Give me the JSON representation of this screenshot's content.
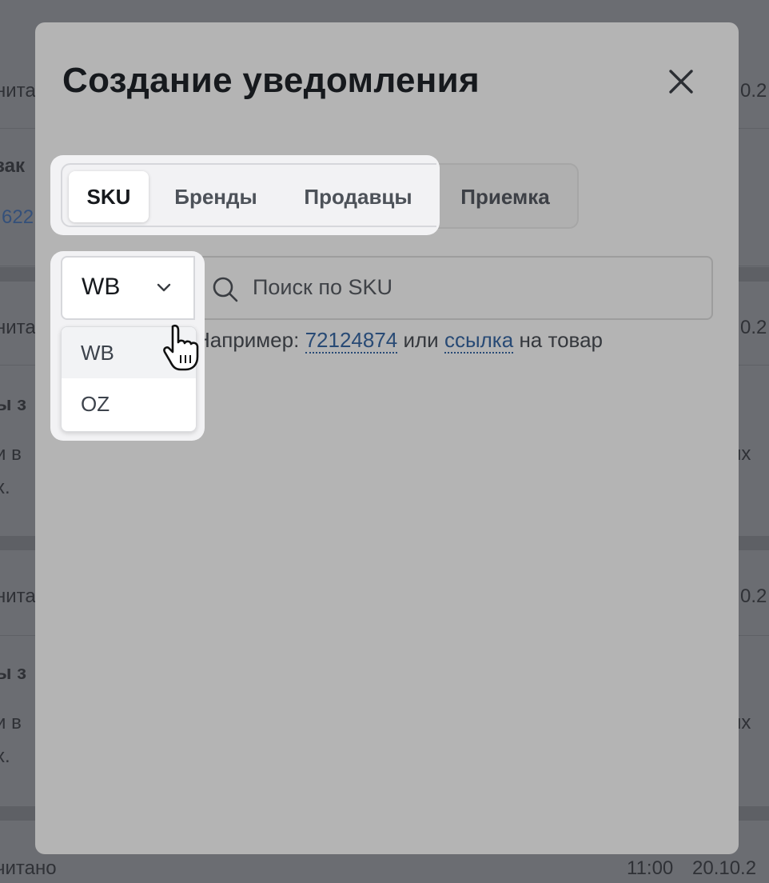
{
  "background": {
    "rows": [
      {
        "text": "нита",
        "right": "0.2"
      },
      {
        "bold": "зак",
        "link": "622"
      },
      {
        "text": "нита",
        "right": "0.2"
      },
      {
        "bold": "ы з",
        "line2": "и в",
        "line3": "х.",
        "right": "их"
      },
      {
        "text": "нита",
        "right": "0.2"
      },
      {
        "bold": "ы з",
        "line2": "и в",
        "line3": "х.",
        "right": "их"
      },
      {
        "text": "читано",
        "time": "11:00",
        "date": "20.10.2"
      }
    ]
  },
  "modal": {
    "title": "Создание уведомления",
    "close_icon": "close-icon",
    "tabs": [
      {
        "label": "SKU",
        "active": true
      },
      {
        "label": "Бренды",
        "active": false
      },
      {
        "label": "Продавцы",
        "active": false
      },
      {
        "label": "Приемка",
        "active": false
      }
    ],
    "marketplace_select": {
      "value": "WB",
      "icon": "chevron-down-icon",
      "options": [
        {
          "label": "WB",
          "selected": true
        },
        {
          "label": "OZ",
          "selected": false
        }
      ]
    },
    "search": {
      "icon": "search-icon",
      "placeholder": "Поиск по SKU",
      "value": ""
    },
    "hint": {
      "prefix": "Например:",
      "example_sku": "72124874",
      "middle": "или",
      "example_link": "ссылка",
      "suffix": "на товар"
    }
  },
  "colors": {
    "overlay": "#66686d",
    "modal": "#b4b4b4",
    "highlight": "#f2f2f4",
    "link": "#284a75"
  }
}
